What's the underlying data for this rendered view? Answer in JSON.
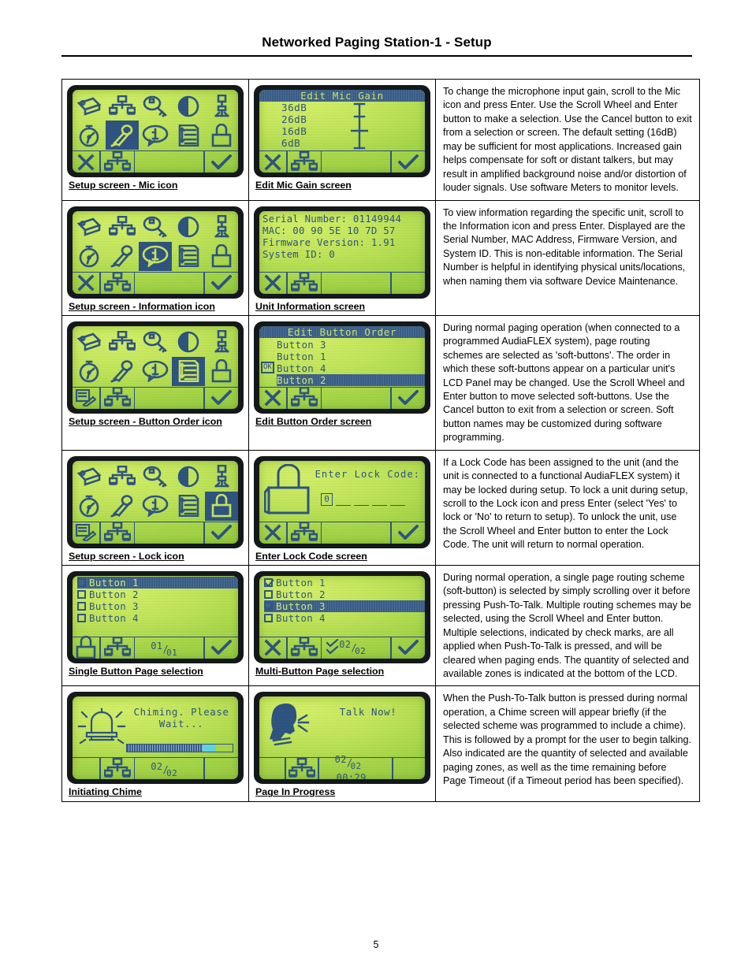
{
  "header": {
    "title": "Networked Paging Station-1 -  Setup"
  },
  "footer": {
    "page_number": "5"
  },
  "rows": [
    {
      "left": {
        "caption": "Setup screen - Mic icon",
        "type": "setup-grid",
        "selected_icon": "mic-icon",
        "icons": [
          "nametag-icon",
          "network-icon",
          "magnifier-key-icon",
          "contrast-icon",
          "mic-stand-icon",
          "stopwatch-icon",
          "mic-icon",
          "info-bubble-icon",
          "button-order-icon",
          "lock-icon"
        ],
        "bar": {
          "left": "cancel-x-icon",
          "second": "network-icon",
          "right": "check-icon"
        }
      },
      "right": {
        "caption": "Edit Mic Gain screen",
        "type": "gain-list",
        "title": "Edit Mic Gain",
        "options": [
          "36dB",
          "26dB",
          "16dB",
          "6dB"
        ],
        "selected": "16dB",
        "bar": {
          "left": "cancel-x-icon",
          "second": "network-icon",
          "right": "check-icon"
        }
      },
      "description": "To change the microphone input gain, scroll to the Mic icon and press Enter.  Use the Scroll Wheel and Enter button to make a selection.  Use the Cancel button to exit from a selection or screen.  The default setting (16dB) may be sufficient for most applications.  Increased gain helps compensate for soft or distant talkers, but may result in amplified background noise and/or distortion of louder signals.  Use software Meters to monitor levels."
    },
    {
      "left": {
        "caption": "Setup screen - Information icon",
        "type": "setup-grid",
        "selected_icon": "info-bubble-icon",
        "icons": [
          "nametag-icon",
          "network-icon",
          "magnifier-key-icon",
          "contrast-icon",
          "mic-stand-icon",
          "stopwatch-icon",
          "mic-icon",
          "info-bubble-icon",
          "button-order-icon",
          "lock-icon"
        ],
        "bar": {
          "left": "cancel-x-icon",
          "second": "network-icon",
          "right": "check-icon"
        }
      },
      "right": {
        "caption": "Unit Information screen",
        "type": "info",
        "lines": [
          "Serial Number: 01149944",
          "MAC: 00 90 5E 10 7D 57",
          "Firmware Version: 1.91",
          "System ID: 0"
        ],
        "bar": {
          "left": "cancel-x-icon",
          "second": "network-icon",
          "right": ""
        }
      },
      "description": "To view information regarding the specific unit, scroll to the Information icon and press Enter.  Displayed are the Serial Number, MAC Address, Firmware Version, and System ID.  This is non-editable information.  The Serial Number is helpful in identifying physical units/locations, when naming them via software Device Maintenance."
    },
    {
      "left": {
        "caption": "Setup screen - Button Order icon",
        "type": "setup-grid",
        "selected_icon": "button-order-icon",
        "icons": [
          "nametag-icon",
          "network-icon",
          "magnifier-key-icon",
          "contrast-icon",
          "mic-stand-icon",
          "stopwatch-icon",
          "mic-icon",
          "info-bubble-icon",
          "button-order-icon",
          "lock-icon"
        ],
        "bar": {
          "left": "edit-note-icon",
          "second": "network-icon",
          "right": "check-icon"
        }
      },
      "right": {
        "caption": "Edit Button Order screen",
        "type": "order-list",
        "title": "Edit Button Order",
        "items": [
          "Button 3",
          "Button 1",
          "Button 4",
          "Button 2"
        ],
        "highlighted": "Button 2",
        "ok_marker": "OK",
        "ok_marker_row": 2,
        "bar": {
          "left": "cancel-x-icon",
          "second": "network-icon",
          "right": "check-icon"
        }
      },
      "description": "During normal paging operation (when connected to a programmed AudiaFLEX system), page routing schemes are selected as 'soft-buttons'.  The order in which these soft-buttons appear on a particular unit's LCD Panel may be changed.  Use the Scroll Wheel and Enter button to move selected soft-buttons.  Use the Cancel button to exit from a selection or screen.  Soft button names may be customized during software programming."
    },
    {
      "left": {
        "caption": "Setup screen - Lock icon",
        "type": "setup-grid",
        "selected_icon": "lock-icon",
        "icons": [
          "nametag-icon",
          "network-icon",
          "magnifier-key-icon",
          "contrast-icon",
          "mic-stand-icon",
          "stopwatch-icon",
          "mic-icon",
          "info-bubble-icon",
          "button-order-icon",
          "lock-icon"
        ],
        "bar": {
          "left": "edit-note-icon",
          "second": "network-icon",
          "right": "check-icon"
        }
      },
      "right": {
        "caption": "Enter Lock Code screen",
        "type": "lock-code",
        "prompt": "Enter Lock Code:",
        "first_digit": "0",
        "blank_count": 4,
        "bar": {
          "left": "cancel-x-icon",
          "second": "network-icon",
          "right": "check-icon"
        }
      },
      "description": "If a Lock Code has been assigned to the unit (and the unit is connected to a functional AudiaFLEX system) it may be locked during setup.  To lock a unit during setup, scroll to the Lock icon and press Enter (select 'Yes' to lock or 'No' to return to setup).  To unlock the unit, use the Scroll Wheel and Enter button to enter the Lock Code.  The unit will return to normal operation."
    },
    {
      "left": {
        "caption": "Single Button Page selection",
        "type": "check-list",
        "items": [
          {
            "label": "Button 1",
            "checked": false,
            "highlighted": true
          },
          {
            "label": "Button 2",
            "checked": false,
            "highlighted": false
          },
          {
            "label": "Button 3",
            "checked": false,
            "highlighted": false
          },
          {
            "label": "Button 4",
            "checked": false,
            "highlighted": false
          }
        ],
        "count_selected": "01",
        "count_total": "01",
        "bar": {
          "left": "lock-icon",
          "second": "network-icon",
          "right": "check-icon",
          "show_count": true,
          "show_checks": false
        }
      },
      "right": {
        "caption": "Multi-Button Page selection",
        "type": "check-list",
        "items": [
          {
            "label": "Button 1",
            "checked": true,
            "highlighted": false
          },
          {
            "label": "Button 2",
            "checked": false,
            "highlighted": false
          },
          {
            "label": "Button 3",
            "checked": true,
            "highlighted": true
          },
          {
            "label": "Button 4",
            "checked": false,
            "highlighted": false
          }
        ],
        "count_selected": "02",
        "count_total": "02",
        "bar": {
          "left": "cancel-x-icon",
          "second": "network-icon",
          "right": "check-icon",
          "show_count": true,
          "show_checks": true
        }
      },
      "description": "During normal operation, a single page routing scheme (soft-button) is selected by simply scrolling over it before pressing Push-To-Talk.  Multiple routing schemes may be selected, using the Scroll Wheel and Enter button.  Multiple selections, indicated by check marks, are all applied when Push-To-Talk is pressed, and will be cleared when paging ends.  The quantity of selected and available zones is indicated at the bottom of the LCD."
    },
    {
      "left": {
        "caption": "Initiating Chime",
        "type": "chime",
        "message": "Chiming. Please Wait...",
        "progress_percent": 72,
        "count_selected": "02",
        "count_total": "02",
        "bar": {
          "left": "",
          "second": "network-icon",
          "right": ""
        }
      },
      "right": {
        "caption": "Page In Progress",
        "type": "talk",
        "message": "Talk Now!",
        "count_selected": "02",
        "count_total": "02",
        "timer": "00:29",
        "bar": {
          "left": "",
          "second": "network-icon",
          "right": ""
        }
      },
      "description": "When the Push-To-Talk button is pressed during normal operation, a Chime screen will appear briefly (if the selected scheme was programmed to include a chime).  This is followed by a prompt for the user to begin talking.  Also indicated are the quantity of selected and available paging zones, as well as the time remaining before Page Timeout (if a Timeout period has been specified)."
    }
  ]
}
